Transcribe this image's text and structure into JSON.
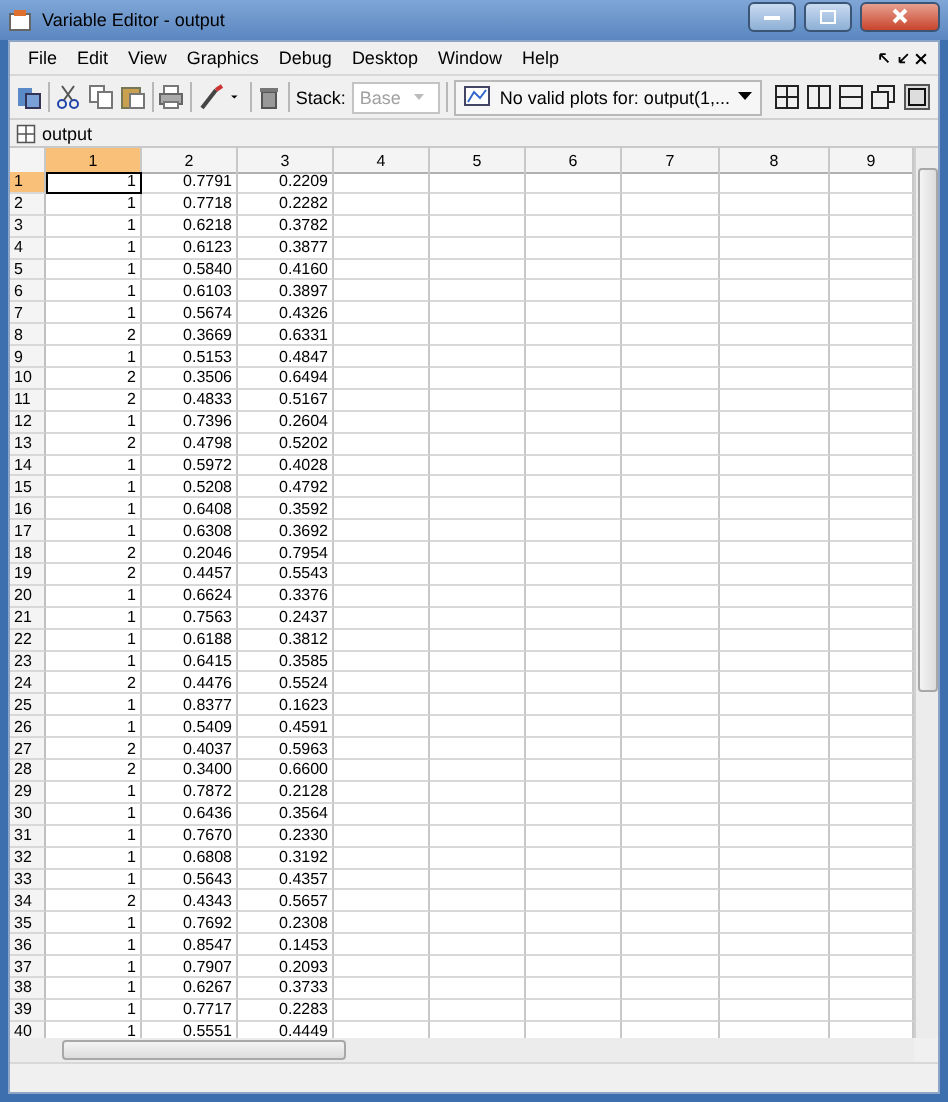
{
  "window": {
    "title": "Variable Editor - output"
  },
  "menu": [
    "File",
    "Edit",
    "View",
    "Graphics",
    "Debug",
    "Desktop",
    "Window",
    "Help"
  ],
  "toolbar": {
    "stack_label": "Stack:",
    "stack_value": "Base",
    "stack_disabled": true,
    "plot_selector": "No valid plots for: output(1,..."
  },
  "document_tab": {
    "label": "output"
  },
  "table": {
    "columns": [
      {
        "label": "1",
        "selected": true
      },
      {
        "label": "2",
        "selected": false
      },
      {
        "label": "3",
        "selected": false
      },
      {
        "label": "4",
        "selected": false
      },
      {
        "label": "5",
        "selected": false
      },
      {
        "label": "6",
        "selected": false
      },
      {
        "label": "7",
        "selected": false
      },
      {
        "label": "8",
        "selected": false
      },
      {
        "label": "9",
        "selected": false
      }
    ],
    "rows": [
      {
        "label": "1",
        "selected": true,
        "cells": [
          "1",
          "0.7791",
          "0.2209"
        ]
      },
      {
        "label": "2",
        "selected": false,
        "cells": [
          "1",
          "0.7718",
          "0.2282"
        ]
      },
      {
        "label": "3",
        "selected": false,
        "cells": [
          "1",
          "0.6218",
          "0.3782"
        ]
      },
      {
        "label": "4",
        "selected": false,
        "cells": [
          "1",
          "0.6123",
          "0.3877"
        ]
      },
      {
        "label": "5",
        "selected": false,
        "cells": [
          "1",
          "0.5840",
          "0.4160"
        ]
      },
      {
        "label": "6",
        "selected": false,
        "cells": [
          "1",
          "0.6103",
          "0.3897"
        ]
      },
      {
        "label": "7",
        "selected": false,
        "cells": [
          "1",
          "0.5674",
          "0.4326"
        ]
      },
      {
        "label": "8",
        "selected": false,
        "cells": [
          "2",
          "0.3669",
          "0.6331"
        ]
      },
      {
        "label": "9",
        "selected": false,
        "cells": [
          "1",
          "0.5153",
          "0.4847"
        ]
      },
      {
        "label": "10",
        "selected": false,
        "cells": [
          "2",
          "0.3506",
          "0.6494"
        ]
      },
      {
        "label": "11",
        "selected": false,
        "cells": [
          "2",
          "0.4833",
          "0.5167"
        ]
      },
      {
        "label": "12",
        "selected": false,
        "cells": [
          "1",
          "0.7396",
          "0.2604"
        ]
      },
      {
        "label": "13",
        "selected": false,
        "cells": [
          "2",
          "0.4798",
          "0.5202"
        ]
      },
      {
        "label": "14",
        "selected": false,
        "cells": [
          "1",
          "0.5972",
          "0.4028"
        ]
      },
      {
        "label": "15",
        "selected": false,
        "cells": [
          "1",
          "0.5208",
          "0.4792"
        ]
      },
      {
        "label": "16",
        "selected": false,
        "cells": [
          "1",
          "0.6408",
          "0.3592"
        ]
      },
      {
        "label": "17",
        "selected": false,
        "cells": [
          "1",
          "0.6308",
          "0.3692"
        ]
      },
      {
        "label": "18",
        "selected": false,
        "cells": [
          "2",
          "0.2046",
          "0.7954"
        ]
      },
      {
        "label": "19",
        "selected": false,
        "cells": [
          "2",
          "0.4457",
          "0.5543"
        ]
      },
      {
        "label": "20",
        "selected": false,
        "cells": [
          "1",
          "0.6624",
          "0.3376"
        ]
      },
      {
        "label": "21",
        "selected": false,
        "cells": [
          "1",
          "0.7563",
          "0.2437"
        ]
      },
      {
        "label": "22",
        "selected": false,
        "cells": [
          "1",
          "0.6188",
          "0.3812"
        ]
      },
      {
        "label": "23",
        "selected": false,
        "cells": [
          "1",
          "0.6415",
          "0.3585"
        ]
      },
      {
        "label": "24",
        "selected": false,
        "cells": [
          "2",
          "0.4476",
          "0.5524"
        ]
      },
      {
        "label": "25",
        "selected": false,
        "cells": [
          "1",
          "0.8377",
          "0.1623"
        ]
      },
      {
        "label": "26",
        "selected": false,
        "cells": [
          "1",
          "0.5409",
          "0.4591"
        ]
      },
      {
        "label": "27",
        "selected": false,
        "cells": [
          "2",
          "0.4037",
          "0.5963"
        ]
      },
      {
        "label": "28",
        "selected": false,
        "cells": [
          "2",
          "0.3400",
          "0.6600"
        ]
      },
      {
        "label": "29",
        "selected": false,
        "cells": [
          "1",
          "0.7872",
          "0.2128"
        ]
      },
      {
        "label": "30",
        "selected": false,
        "cells": [
          "1",
          "0.6436",
          "0.3564"
        ]
      },
      {
        "label": "31",
        "selected": false,
        "cells": [
          "1",
          "0.7670",
          "0.2330"
        ]
      },
      {
        "label": "32",
        "selected": false,
        "cells": [
          "1",
          "0.6808",
          "0.3192"
        ]
      },
      {
        "label": "33",
        "selected": false,
        "cells": [
          "1",
          "0.5643",
          "0.4357"
        ]
      },
      {
        "label": "34",
        "selected": false,
        "cells": [
          "2",
          "0.4343",
          "0.5657"
        ]
      },
      {
        "label": "35",
        "selected": false,
        "cells": [
          "1",
          "0.7692",
          "0.2308"
        ]
      },
      {
        "label": "36",
        "selected": false,
        "cells": [
          "1",
          "0.8547",
          "0.1453"
        ]
      },
      {
        "label": "37",
        "selected": false,
        "cells": [
          "1",
          "0.7907",
          "0.2093"
        ]
      },
      {
        "label": "38",
        "selected": false,
        "cells": [
          "1",
          "0.6267",
          "0.3733"
        ]
      },
      {
        "label": "39",
        "selected": false,
        "cells": [
          "1",
          "0.7717",
          "0.2283"
        ]
      },
      {
        "label": "40",
        "selected": false,
        "cells": [
          "1",
          "0.5551",
          "0.4449"
        ]
      }
    ]
  }
}
